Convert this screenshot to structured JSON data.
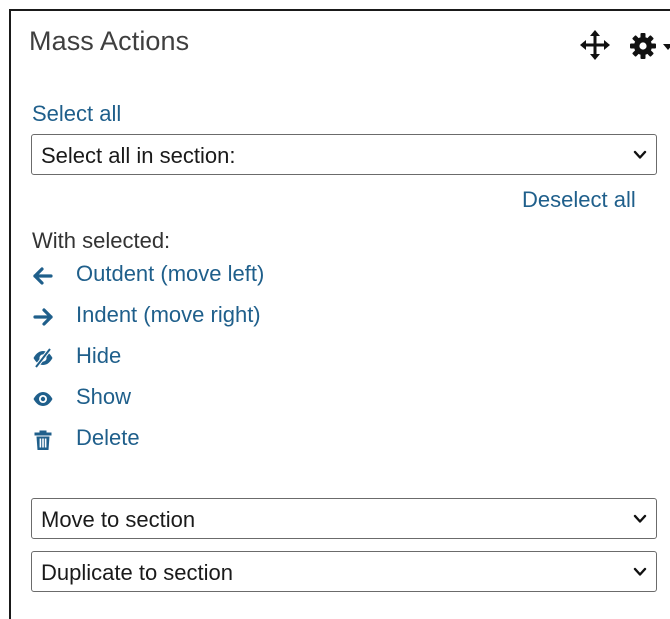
{
  "block": {
    "title": "Mass Actions",
    "select_all_label": "Select all",
    "section_select_value": "Select all in section:",
    "deselect_all_label": "Deselect all",
    "with_selected_label": "With selected:",
    "actions": [
      {
        "label": "Outdent (move left)",
        "icon": "arrow-left-icon"
      },
      {
        "label": "Indent (move right)",
        "icon": "arrow-right-icon"
      },
      {
        "label": "Hide",
        "icon": "eye-slash-icon"
      },
      {
        "label": "Show",
        "icon": "eye-icon"
      },
      {
        "label": "Delete",
        "icon": "trash-icon"
      }
    ],
    "move_to_section_value": "Move to section",
    "duplicate_to_section_value": "Duplicate to section"
  },
  "colors": {
    "link": "#1f5f8b",
    "title": "#3f3f3f",
    "border": "#1a1a1a"
  }
}
